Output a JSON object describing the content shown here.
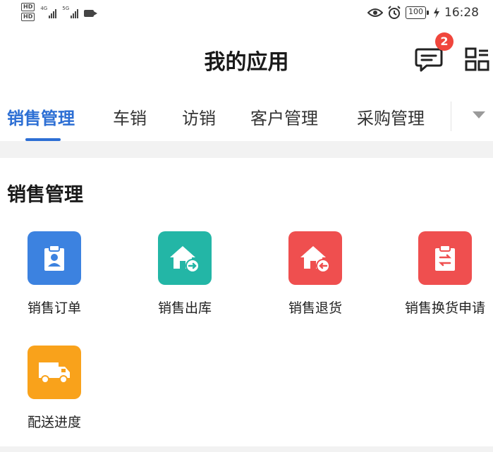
{
  "status_bar": {
    "hd_badges": [
      "HD",
      "HD"
    ],
    "signal_1": "4G",
    "signal_2": "5G",
    "battery": "100",
    "time": "16:28",
    "icons": [
      "eye-icon",
      "alarm-icon",
      "charging-icon",
      "video-icon"
    ]
  },
  "header": {
    "title": "我的应用",
    "message_badge_count": "2",
    "icons": [
      "message-icon",
      "grid-apps-icon"
    ]
  },
  "tabs": [
    {
      "label": "销售管理",
      "active": true
    },
    {
      "label": "车销",
      "active": false
    },
    {
      "label": "访销",
      "active": false
    },
    {
      "label": "客户管理",
      "active": false
    },
    {
      "label": "采购管理",
      "active": false
    }
  ],
  "section": {
    "title": "销售管理",
    "apps": [
      {
        "label": "销售订单",
        "icon": "clipboard-user-icon",
        "color": "#3c82e0"
      },
      {
        "label": "销售出库",
        "icon": "house-out-icon",
        "color": "#23b6a6"
      },
      {
        "label": "销售退货",
        "icon": "house-return-icon",
        "color": "#ef4f4f"
      },
      {
        "label": "销售换货申请",
        "icon": "clipboard-exchange-icon",
        "color": "#ef4f4f"
      },
      {
        "label": "配送进度",
        "icon": "truck-icon",
        "color": "#f9a21b"
      }
    ]
  },
  "colors": {
    "accent": "#2d6fd4",
    "badge": "#f0463c"
  }
}
